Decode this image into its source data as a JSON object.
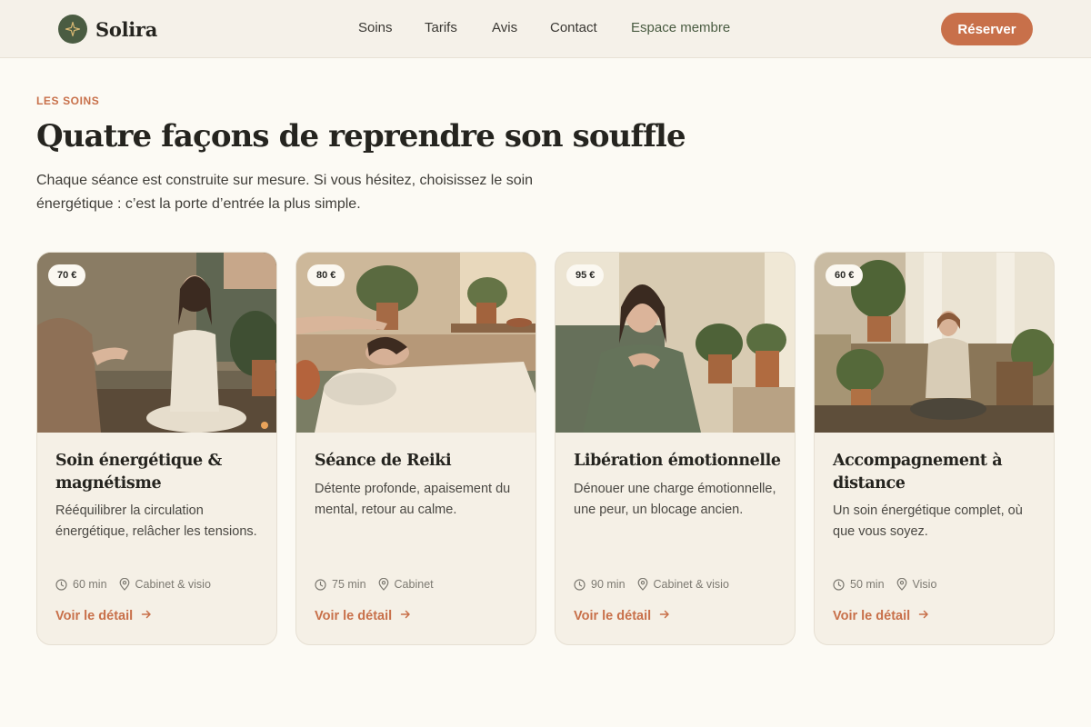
{
  "brand": {
    "name": "Solira",
    "logo_icon": "sparkle-icon"
  },
  "nav": {
    "items": [
      "Soins",
      "Tarifs",
      "Avis",
      "Contact"
    ],
    "member": "Espace membre",
    "cta": "Réserver"
  },
  "hero": {
    "eyebrow": "LES SOINS",
    "title": "Quatre façons de reprendre son souffle",
    "intro": "Chaque séance est construite sur mesure. Si vous hésitez, choisissez le soin énergétique : c’est la porte d’entrée la plus simple."
  },
  "cards": [
    {
      "price": "70 €",
      "title": "Soin énergétique & magnétisme",
      "description": "Rééquilibrer la circulation énergétique, relâcher les tensions.",
      "duration": "60 min",
      "location": "Cabinet & visio",
      "link": "Voir le détail"
    },
    {
      "price": "80 €",
      "title": "Séance de Reiki",
      "description": "Détente profonde, apaisement du mental, retour au calme.",
      "duration": "75 min",
      "location": "Cabinet",
      "link": "Voir le détail"
    },
    {
      "price": "95 €",
      "title": "Libération émotionnelle",
      "description": "Dénouer une charge émotionnelle, une peur, un blocage ancien.",
      "duration": "90 min",
      "location": "Cabinet & visio",
      "link": "Voir le détail"
    },
    {
      "price": "60 €",
      "title": "Accompagnement à distance",
      "description": "Un soin énergétique complet, où que vous soyez.",
      "duration": "50 min",
      "location": "Visio",
      "link": "Voir le détail"
    }
  ],
  "colors": {
    "accent": "#c8704a",
    "brand_green": "#4a5c42",
    "background": "#fcfaf4",
    "card": "#f5f0e6"
  },
  "icons": {
    "duration": "clock-icon",
    "location": "map-pin-icon",
    "link": "arrow-right-icon"
  }
}
